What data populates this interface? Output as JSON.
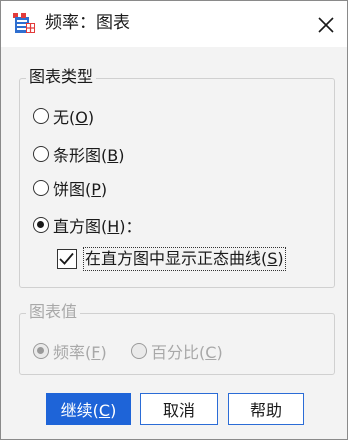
{
  "window": {
    "title": "频率：图表"
  },
  "chart_type_group": {
    "legend": "图表类型",
    "options": [
      {
        "label": "无",
        "mnemonic": "O",
        "selected": false
      },
      {
        "label": "条形图",
        "mnemonic": "B",
        "selected": false
      },
      {
        "label": "饼图",
        "mnemonic": "P",
        "selected": false
      },
      {
        "label": "直方图",
        "mnemonic": "H",
        "suffix": "：",
        "selected": true
      }
    ],
    "normal_curve": {
      "label": "在直方图中显示正态曲线",
      "mnemonic": "S",
      "checked": true
    }
  },
  "chart_values_group": {
    "legend": "图表值",
    "enabled": false,
    "options": [
      {
        "label": "频率",
        "mnemonic": "F",
        "selected": true
      },
      {
        "label": "百分比",
        "mnemonic": "C",
        "selected": false
      }
    ]
  },
  "buttons": {
    "continue": {
      "label": "继续",
      "mnemonic": "C"
    },
    "cancel": {
      "label": "取消"
    },
    "help": {
      "label": "帮助"
    }
  },
  "colors": {
    "primary": "#1e64d8",
    "dialog_bg": "#f3f3f3",
    "disabled_text": "#a8a8a8"
  }
}
